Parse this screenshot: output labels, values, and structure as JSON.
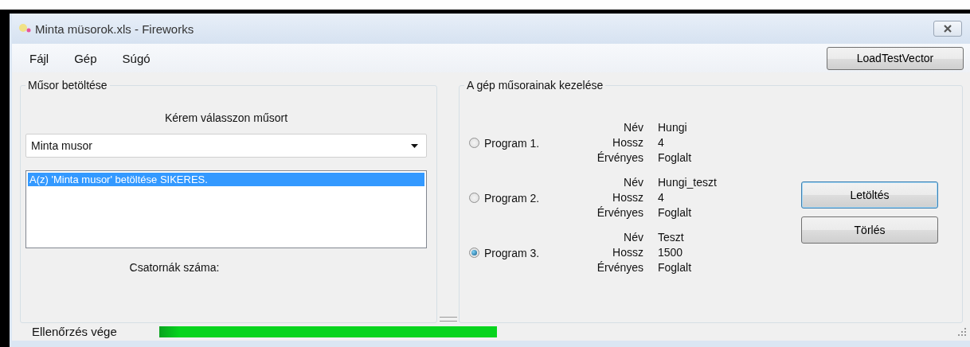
{
  "window": {
    "title": "Minta müsorok.xls - Fireworks"
  },
  "menu": [
    {
      "label": "Fájl"
    },
    {
      "label": "Gép"
    },
    {
      "label": "Súgó"
    }
  ],
  "toolbar_button": "LoadTestVector",
  "load_group": {
    "title": "Műsor betöltése",
    "prompt": "Kérem válasszon műsort",
    "combo_value": "Minta musor",
    "log": [
      {
        "text": "A(z) 'Minta musor' betöltése SIKERES.",
        "selected": true
      }
    ],
    "channels_label": "Csatornák száma:"
  },
  "machine_group": {
    "title": "A gép műsorainak kezelése",
    "programs": [
      {
        "label": "Program 1.",
        "selected": false,
        "fields": [
          {
            "label": "Név",
            "value": "Hungi"
          },
          {
            "label": "Hossz",
            "value": "4"
          },
          {
            "label": "Érvényes",
            "value": "Foglalt"
          }
        ]
      },
      {
        "label": "Program 2.",
        "selected": false,
        "fields": [
          {
            "label": "Név",
            "value": "Hungi_teszt"
          },
          {
            "label": "Hossz",
            "value": "4"
          },
          {
            "label": "Érvényes",
            "value": "Foglalt"
          }
        ]
      },
      {
        "label": "Program 3.",
        "selected": true,
        "fields": [
          {
            "label": "Név",
            "value": "Teszt"
          },
          {
            "label": "Hossz",
            "value": "1500"
          },
          {
            "label": "Érvényes",
            "value": "Foglalt"
          }
        ]
      }
    ],
    "buttons": [
      {
        "label": "Letöltés",
        "focused": true
      },
      {
        "label": "Törlés",
        "focused": false
      }
    ]
  },
  "status": {
    "label": "Ellenőrzés vége",
    "progress": {
      "level": 1
    }
  }
}
